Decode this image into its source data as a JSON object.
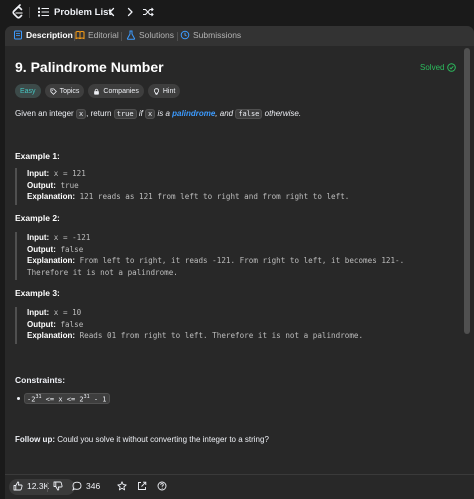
{
  "nav": {
    "problem_list_label": "Problem List"
  },
  "tabs": [
    {
      "label": "Description"
    },
    {
      "label": "Editorial"
    },
    {
      "label": "Solutions"
    },
    {
      "label": "Submissions"
    }
  ],
  "problem": {
    "title": "9. Palindrome Number",
    "status": "Solved",
    "difficulty": "Easy",
    "tag_topics": "Topics",
    "tag_companies": "Companies",
    "tag_hint": "Hint",
    "desc_1": "Given an integer ",
    "desc_code_x": "x",
    "desc_2": ", return ",
    "desc_code_true": "true",
    "desc_3": " if ",
    "desc_code_x2": "x",
    "desc_4": " is a ",
    "desc_link": "palindrome",
    "desc_5": ", and ",
    "desc_code_false": "false",
    "desc_6": " otherwise."
  },
  "examples": [
    {
      "title": "Example 1:",
      "input_label": "Input:",
      "input": "x = 121",
      "output_label": "Output:",
      "output": "true",
      "expl_label": "Explanation:",
      "expl": "121 reads as 121 from left to right and from right to left.",
      "expl_2": ""
    },
    {
      "title": "Example 2:",
      "input_label": "Input:",
      "input": "x = -121",
      "output_label": "Output:",
      "output": "false",
      "expl_label": "Explanation:",
      "expl": "From left to right, it reads -121. From right to left, it becomes 121-.",
      "expl_2": "Therefore it is not a palindrome."
    },
    {
      "title": "Example 3:",
      "input_label": "Input:",
      "input": "x = 10",
      "output_label": "Output:",
      "output": "false",
      "expl_label": "Explanation:",
      "expl": "Reads 01 from right to left. Therefore it is not a palindrome.",
      "expl_2": ""
    }
  ],
  "constraints": {
    "title": "Constraints:",
    "c1_a": "-2",
    "c1_exp1": "31",
    "c1_b": " <= x <= 2",
    "c1_exp2": "31",
    "c1_c": " - 1"
  },
  "followup": {
    "label": "Follow up:",
    "text": " Could you solve it without converting the integer to a string?"
  },
  "bottom": {
    "likes": "12.3K",
    "comments": "346"
  },
  "colors": {
    "accent_solved": "#2cbb5d",
    "easy": "#46c6c2",
    "link": "#3c9bff"
  }
}
